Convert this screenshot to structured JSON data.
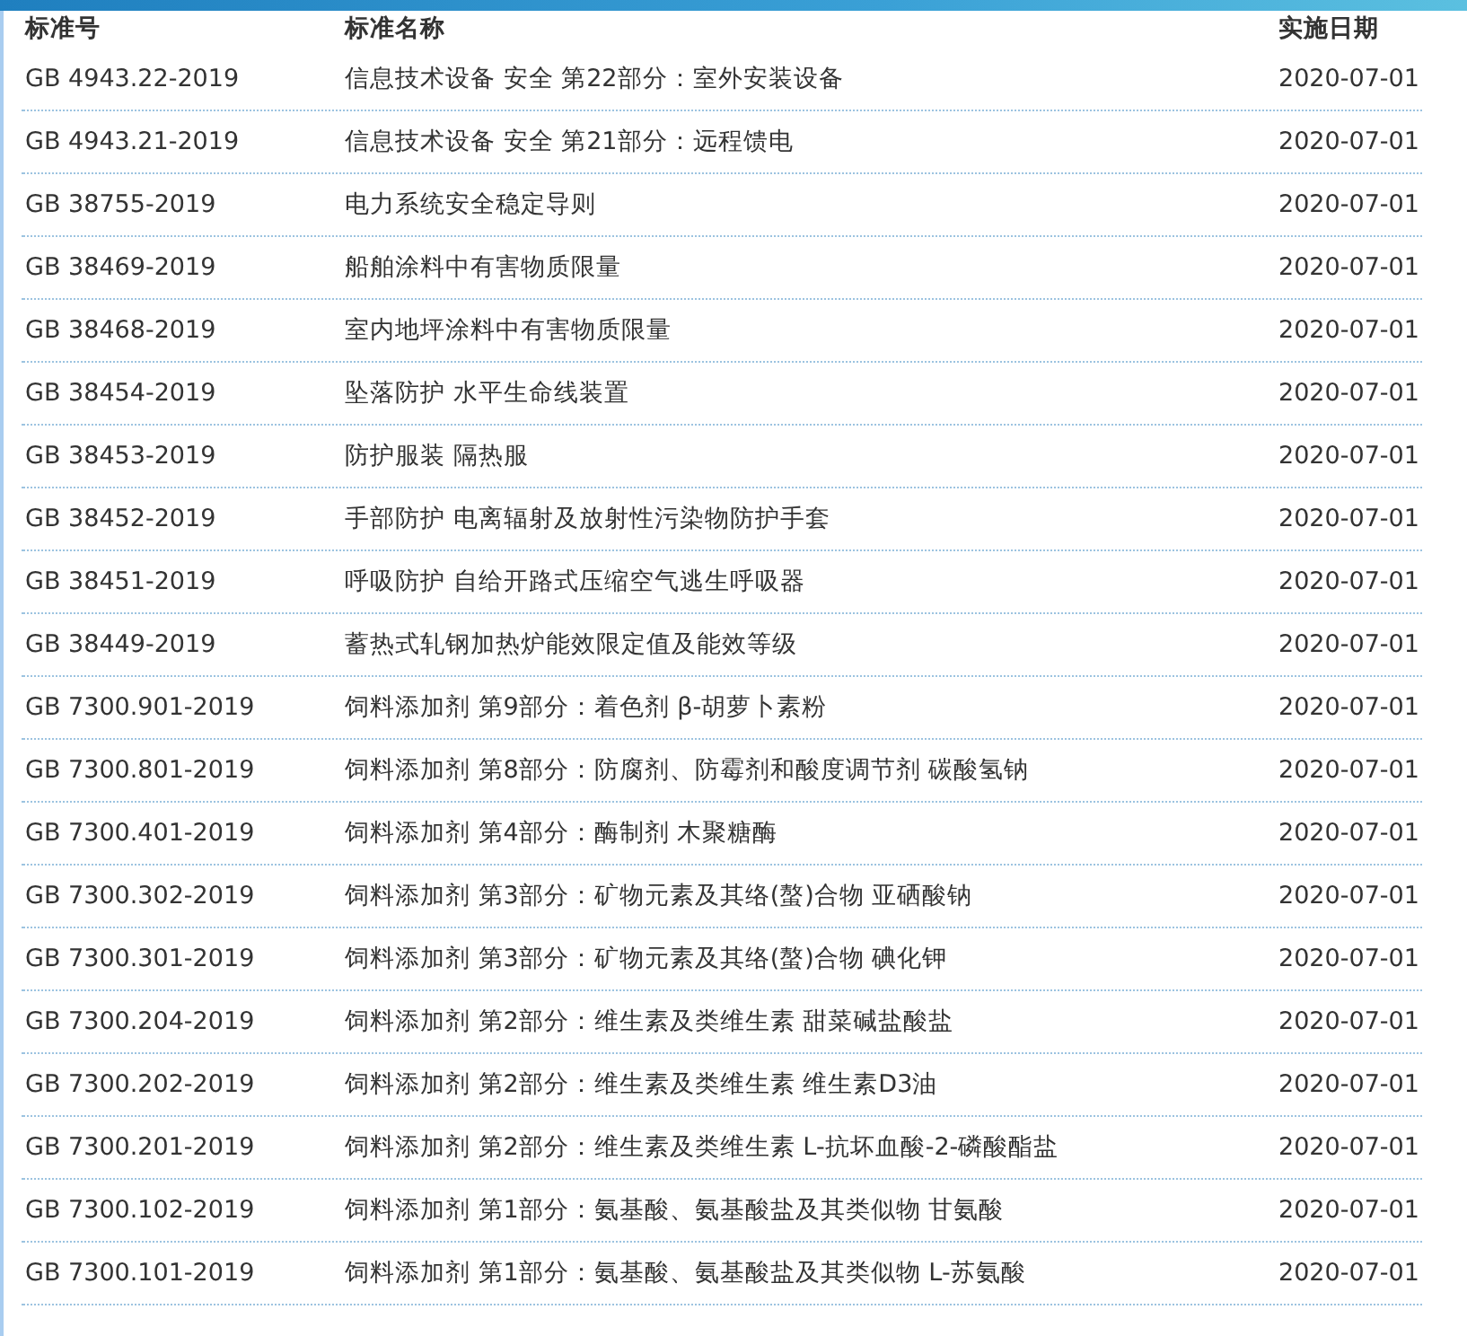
{
  "table": {
    "columns": [
      "标准号",
      "标准名称",
      "实施日期"
    ],
    "rows": [
      {
        "code": "GB 4943.22-2019",
        "name": "信息技术设备 安全 第22部分：室外安装设备",
        "date": "2020-07-01"
      },
      {
        "code": "GB 4943.21-2019",
        "name": "信息技术设备 安全 第21部分：远程馈电",
        "date": "2020-07-01"
      },
      {
        "code": "GB 38755-2019",
        "name": "电力系统安全稳定导则",
        "date": "2020-07-01"
      },
      {
        "code": "GB 38469-2019",
        "name": "船舶涂料中有害物质限量",
        "date": "2020-07-01"
      },
      {
        "code": "GB 38468-2019",
        "name": "室内地坪涂料中有害物质限量",
        "date": "2020-07-01"
      },
      {
        "code": "GB 38454-2019",
        "name": "坠落防护 水平生命线装置",
        "date": "2020-07-01"
      },
      {
        "code": "GB 38453-2019",
        "name": "防护服装 隔热服",
        "date": "2020-07-01"
      },
      {
        "code": "GB 38452-2019",
        "name": "手部防护 电离辐射及放射性污染物防护手套",
        "date": "2020-07-01"
      },
      {
        "code": "GB 38451-2019",
        "name": "呼吸防护 自给开路式压缩空气逃生呼吸器",
        "date": "2020-07-01"
      },
      {
        "code": "GB 38449-2019",
        "name": "蓄热式轧钢加热炉能效限定值及能效等级",
        "date": "2020-07-01"
      },
      {
        "code": "GB 7300.901-2019",
        "name": "饲料添加剂 第9部分：着色剂 β-胡萝卜素粉",
        "date": "2020-07-01"
      },
      {
        "code": "GB 7300.801-2019",
        "name": "饲料添加剂 第8部分：防腐剂、防霉剂和酸度调节剂 碳酸氢钠",
        "date": "2020-07-01"
      },
      {
        "code": "GB 7300.401-2019",
        "name": "饲料添加剂 第4部分：酶制剂 木聚糖酶",
        "date": "2020-07-01"
      },
      {
        "code": "GB 7300.302-2019",
        "name": "饲料添加剂 第3部分：矿物元素及其络(螯)合物 亚硒酸钠",
        "date": "2020-07-01"
      },
      {
        "code": "GB 7300.301-2019",
        "name": "饲料添加剂 第3部分：矿物元素及其络(螯)合物 碘化钾",
        "date": "2020-07-01"
      },
      {
        "code": "GB 7300.204-2019",
        "name": "饲料添加剂 第2部分：维生素及类维生素 甜菜碱盐酸盐",
        "date": "2020-07-01"
      },
      {
        "code": "GB 7300.202-2019",
        "name": "饲料添加剂 第2部分：维生素及类维生素 维生素D3油",
        "date": "2020-07-01"
      },
      {
        "code": "GB 7300.201-2019",
        "name": "饲料添加剂 第2部分：维生素及类维生素 L-抗坏血酸-2-磷酸酯盐",
        "date": "2020-07-01"
      },
      {
        "code": "GB 7300.102-2019",
        "name": "饲料添加剂 第1部分：氨基酸、氨基酸盐及其类似物 甘氨酸",
        "date": "2020-07-01"
      },
      {
        "code": "GB 7300.101-2019",
        "name": "饲料添加剂 第1部分：氨基酸、氨基酸盐及其类似物 L-苏氨酸",
        "date": "2020-07-01"
      }
    ]
  }
}
